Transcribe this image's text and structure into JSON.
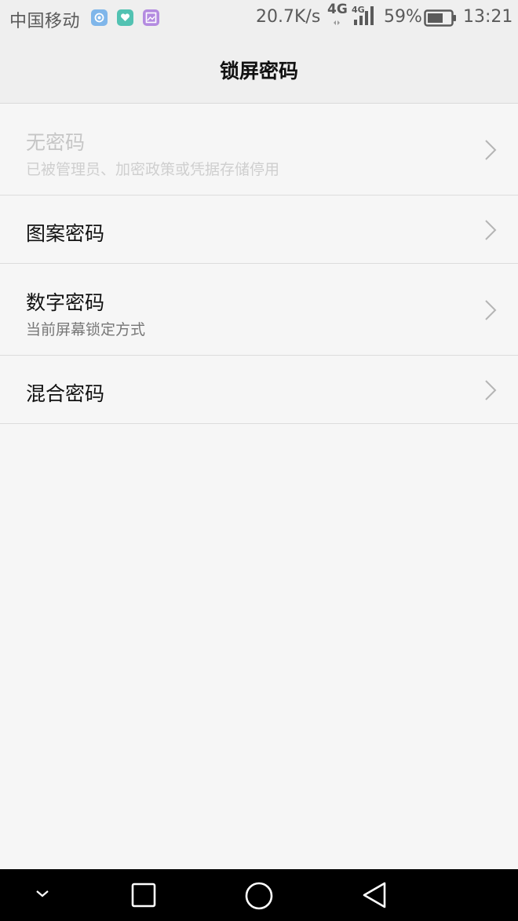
{
  "status_bar": {
    "carrier": "中国移动",
    "net_speed": "20.7K/s",
    "network_type": "4G",
    "network_type_small": "4G",
    "battery": "59%",
    "time": "13:21",
    "notification_icons": [
      "cloud-app-icon",
      "health-app-icon",
      "gallery-app-icon"
    ]
  },
  "header": {
    "title": "锁屏密码"
  },
  "options": [
    {
      "title": "无密码",
      "subtitle": "已被管理员、加密政策或凭据存储停用",
      "enabled": false
    },
    {
      "title": "图案密码",
      "subtitle": "",
      "enabled": true
    },
    {
      "title": "数字密码",
      "subtitle": "当前屏幕锁定方式",
      "enabled": true
    },
    {
      "title": "混合密码",
      "subtitle": "",
      "enabled": true
    }
  ],
  "colors": {
    "background": "#f6f6f6",
    "header_background": "#efefef",
    "nav_bar": "#000000",
    "text_primary": "#111111",
    "text_disabled": "#c6c6c6"
  }
}
